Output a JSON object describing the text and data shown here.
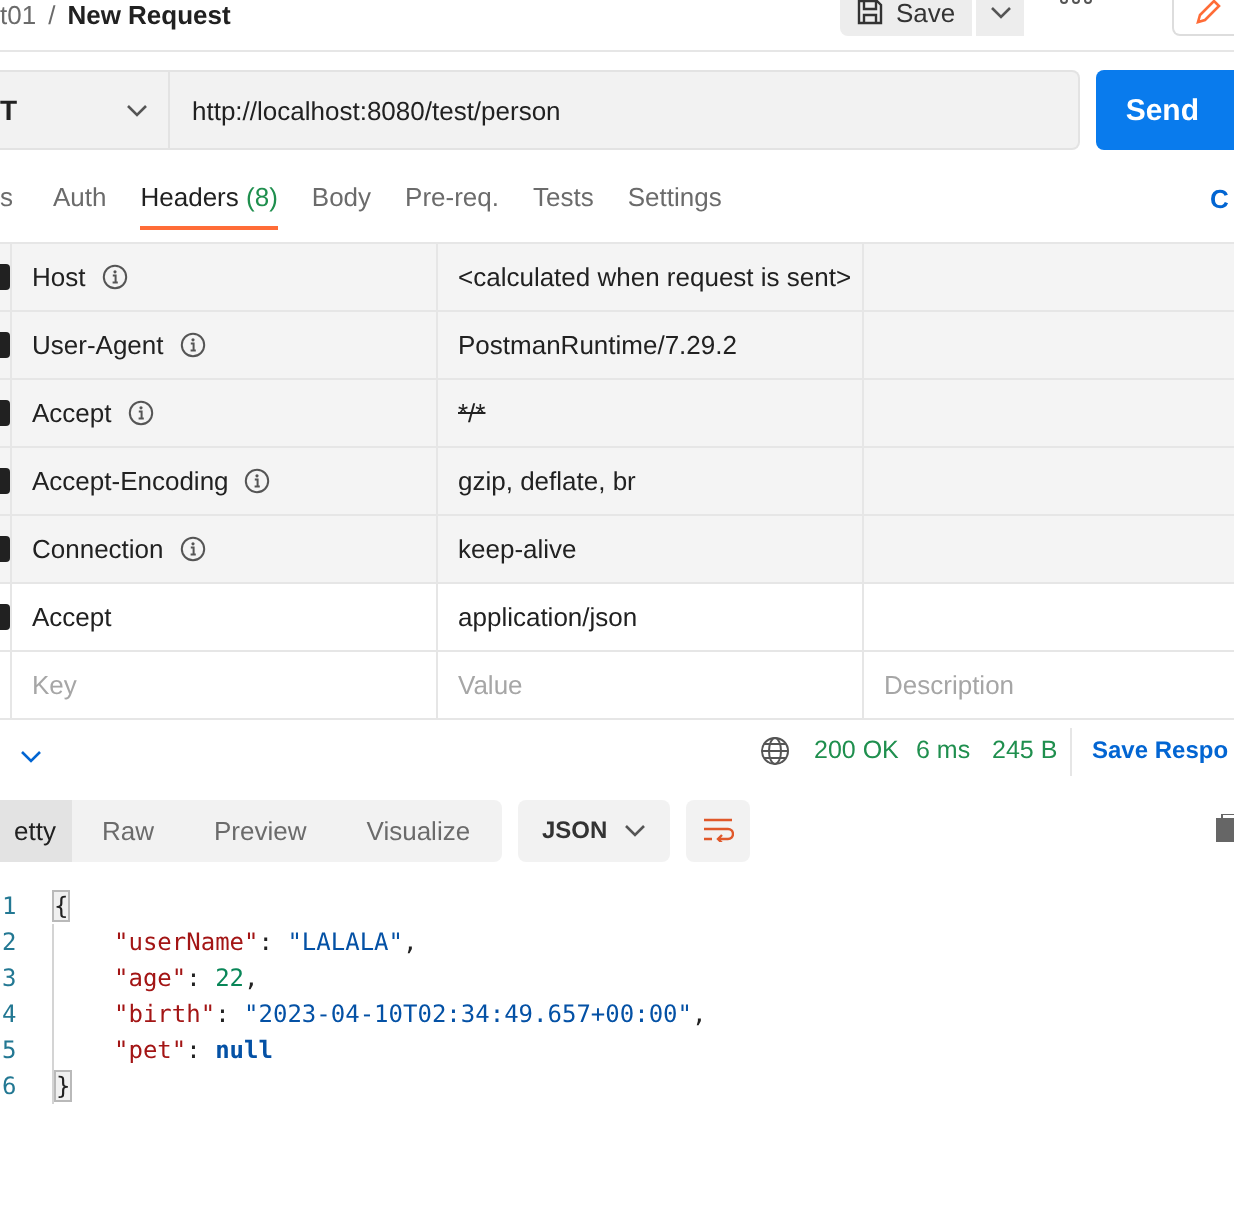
{
  "breadcrumb": {
    "parent": "t01",
    "separator": "/",
    "current": "New Request"
  },
  "toolbar": {
    "save": "Save"
  },
  "request": {
    "method": "T",
    "url": "http://localhost:8080/test/person",
    "send": "Send"
  },
  "tabs": [
    {
      "label": "s",
      "selected": false
    },
    {
      "label": "Auth",
      "selected": false
    },
    {
      "label": "Headers",
      "count": "(8)",
      "selected": true
    },
    {
      "label": "Body",
      "selected": false
    },
    {
      "label": "Pre-req.",
      "selected": false
    },
    {
      "label": "Tests",
      "selected": false
    },
    {
      "label": "Settings",
      "selected": false
    }
  ],
  "tabs_right_link": "C",
  "headers": [
    {
      "key": "Host",
      "value": "<calculated when request is sent>",
      "checked": true,
      "info": true,
      "struck": false
    },
    {
      "key": "User-Agent",
      "value": "PostmanRuntime/7.29.2",
      "checked": true,
      "info": true,
      "struck": false
    },
    {
      "key": "Accept",
      "value": "*/*",
      "checked": true,
      "info": true,
      "struck": true
    },
    {
      "key": "Accept-Encoding",
      "value": "gzip, deflate, br",
      "checked": true,
      "info": true,
      "struck": false
    },
    {
      "key": "Connection",
      "value": "keep-alive",
      "checked": true,
      "info": true,
      "struck": false
    },
    {
      "key": "Accept",
      "value": "application/json",
      "checked": true,
      "info": false,
      "struck": false
    }
  ],
  "new_header": {
    "key_placeholder": "Key",
    "value_placeholder": "Value",
    "description_placeholder": "Description"
  },
  "status": {
    "code": "200 OK",
    "time": "6 ms",
    "size": "245 B",
    "save_link": "Save Respo"
  },
  "view_tabs": [
    {
      "label": "etty",
      "selected": true
    },
    {
      "label": "Raw",
      "selected": false
    },
    {
      "label": "Preview",
      "selected": false
    },
    {
      "label": "Visualize",
      "selected": false
    }
  ],
  "format": "JSON",
  "code_lines": [
    {
      "number": "1",
      "indented": false,
      "tokens": [
        {
          "kind": "brace",
          "text": "{"
        }
      ]
    },
    {
      "number": "2",
      "indented": true,
      "tokens": [
        {
          "kind": "key",
          "text": "\"userName\""
        },
        {
          "kind": "punct",
          "text": ": "
        },
        {
          "kind": "string",
          "text": "\"LALALA\""
        },
        {
          "kind": "punct",
          "text": ","
        }
      ]
    },
    {
      "number": "3",
      "indented": true,
      "tokens": [
        {
          "kind": "key",
          "text": "\"age\""
        },
        {
          "kind": "punct",
          "text": ": "
        },
        {
          "kind": "number",
          "text": "22"
        },
        {
          "kind": "punct",
          "text": ","
        }
      ]
    },
    {
      "number": "4",
      "indented": true,
      "tokens": [
        {
          "kind": "key",
          "text": "\"birth\""
        },
        {
          "kind": "punct",
          "text": ": "
        },
        {
          "kind": "string",
          "text": "\"2023-04-10T02:34:49.657+00:00\""
        },
        {
          "kind": "punct",
          "text": ","
        }
      ]
    },
    {
      "number": "5",
      "indented": true,
      "tokens": [
        {
          "kind": "key",
          "text": "\"pet\""
        },
        {
          "kind": "punct",
          "text": ": "
        },
        {
          "kind": "null",
          "text": "null"
        }
      ]
    },
    {
      "number": "6",
      "indented": false,
      "tokens": [
        {
          "kind": "brace",
          "text": "}"
        }
      ]
    }
  ]
}
